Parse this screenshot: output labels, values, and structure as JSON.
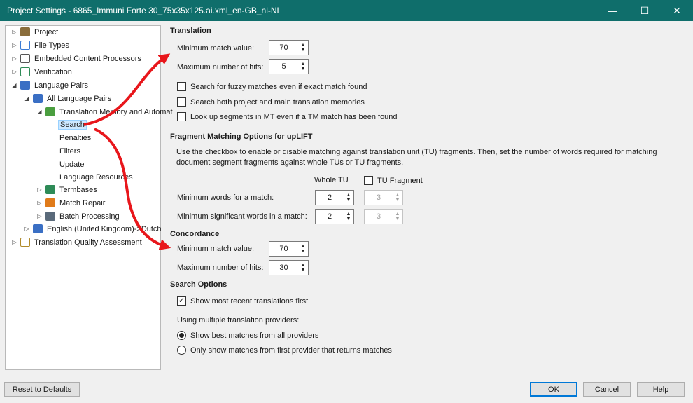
{
  "window": {
    "title": "Project Settings - 6865_Immuni Forte 30_75x35x125.ai.xml_en-GB_nl-NL",
    "minimize": "—",
    "maximize": "☐",
    "close": "✕"
  },
  "tree": {
    "project": "Project",
    "file_types": "File Types",
    "embedded": "Embedded Content Processors",
    "verification": "Verification",
    "language_pairs": "Language Pairs",
    "all_language_pairs": "All Language Pairs",
    "tm_auto": "Translation Memory and Automat",
    "search": "Search",
    "penalties": "Penalties",
    "filters": "Filters",
    "update": "Update",
    "language_resources": "Language Resources",
    "termbases": "Termbases",
    "match_repair": "Match Repair",
    "batch_processing": "Batch Processing",
    "english": "English (United Kingdom)->Dutch",
    "tqa": "Translation Quality Assessment"
  },
  "translation": {
    "heading": "Translation",
    "min_match_label": "Minimum match value:",
    "min_match_value": "70",
    "max_hits_label": "Maximum number of hits:",
    "max_hits_value": "5",
    "fuzzy_label": "Search for fuzzy matches even if exact match found",
    "fuzzy_checked": false,
    "both_label": "Search both project and main translation memories",
    "both_checked": false,
    "mt_label": "Look up segments in MT even if a TM match has been found",
    "mt_checked": false
  },
  "fragment": {
    "heading": "Fragment Matching Options for upLIFT",
    "desc": "Use the checkbox to enable or disable matching against translation unit (TU)  fragments. Then, set the number of words required for matching document segment fragments against whole TUs or TU fragments.",
    "whole_tu": "Whole TU",
    "tu_fragment": "TU Fragment",
    "tu_fragment_checked": false,
    "min_words_label": "Minimum words for a match:",
    "min_words_whole": "2",
    "min_words_frag": "3",
    "min_sig_label": "Minimum significant words in a match:",
    "min_sig_whole": "2",
    "min_sig_frag": "3"
  },
  "concordance": {
    "heading": "Concordance",
    "min_match_label": "Minimum match value:",
    "min_match_value": "70",
    "max_hits_label": "Maximum number of hits:",
    "max_hits_value": "30"
  },
  "search_options": {
    "heading": "Search Options",
    "recent_label": "Show most recent translations first",
    "recent_checked": true,
    "multiple_label": "Using multiple translation providers:",
    "best_label": "Show best matches from all providers",
    "first_label": "Only show matches from first provider that returns matches",
    "selected": "best"
  },
  "buttons": {
    "reset": "Reset to Defaults",
    "ok": "OK",
    "cancel": "Cancel",
    "help": "Help"
  },
  "colors": {
    "titlebar": "#0f6e6b",
    "arrow": "#e8161b",
    "selection": "#cce8ff"
  }
}
